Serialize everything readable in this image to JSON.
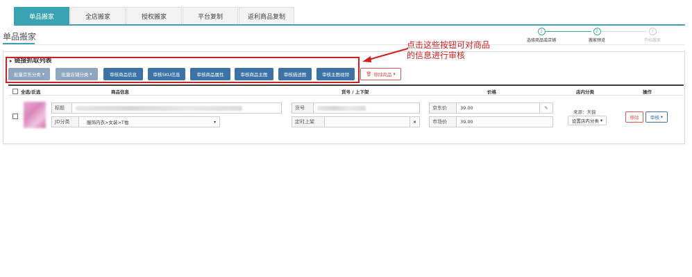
{
  "tabs": [
    {
      "label": "单品搬家"
    },
    {
      "label": "全店搬家"
    },
    {
      "label": "授权搬家"
    },
    {
      "label": "平台复制"
    },
    {
      "label": "返利商品复制"
    }
  ],
  "page_title": "单品搬家",
  "steps": [
    {
      "num": "1",
      "label": "选择商品或店铺"
    },
    {
      "num": "2",
      "label": "搬家预览"
    },
    {
      "num": "3",
      "label": "开始搬家"
    }
  ],
  "panel": {
    "title": "链接抓取列表"
  },
  "toolbar": {
    "batch_jd_category": "批量京东分类",
    "batch_shop_category": "批量店铺分类",
    "audit_product_info": "审核商品信息",
    "audit_sku_info": "审核SKU信息",
    "audit_product_attr": "审核商品属性",
    "audit_product_main_img": "审核商品主图",
    "audit_desc_img": "审核描述图",
    "audit_main_video": "审核主图视频",
    "remove_product": "移除商品"
  },
  "annotation": "点击这些按钮可对商品的信息进行审核",
  "table": {
    "headers": {
      "select_all": "全选/反选",
      "product_info": "商品信息",
      "sku_shelf": "货号 / 上下架",
      "price": "价格",
      "shop_category": "店内分类",
      "actions": "操作"
    },
    "row": {
      "title_label": "标题",
      "jd_category_label": "JD分类",
      "jd_category_value": "服饰内衣>女装>T恤",
      "sku_label": "货号",
      "timed_shelf_label": "定时上架",
      "clear_symbol": "×",
      "jd_price_label": "京东价",
      "jd_price_value": "39.00",
      "market_price_label": "市场价",
      "market_price_value": "39.00",
      "source_text": "来源：天猫",
      "set_shop_category": "设置店内分类",
      "remove_label": "移除",
      "audit_label": "审核"
    }
  },
  "colors": {
    "accent": "#3aa3b3",
    "primary_button": "#3c72a6",
    "secondary_button": "#8ea6c0",
    "danger": "#d9534f",
    "annotation": "#d0201d"
  }
}
